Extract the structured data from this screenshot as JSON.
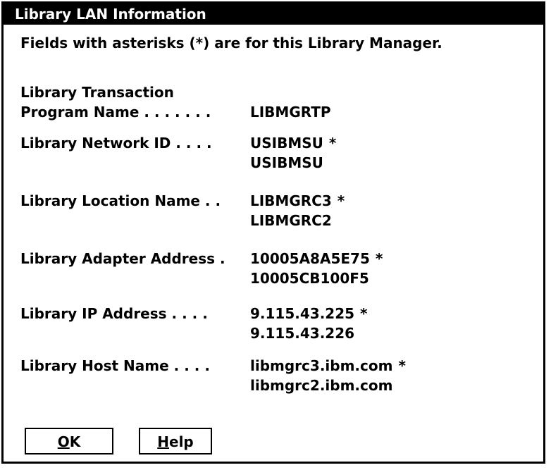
{
  "window": {
    "title": "Library LAN Information",
    "intro": "Fields with asterisks (*) are for this Library Manager."
  },
  "fields": [
    {
      "label_lines": [
        "Library Transaction",
        "Program Name . . . . . . ."
      ],
      "values": [
        {
          "text": "LIBMGRTP",
          "marker": ""
        }
      ]
    },
    {
      "label_lines": [
        "Library Network ID . . . ."
      ],
      "values": [
        {
          "text": "USIBMSU",
          "marker": "*"
        },
        {
          "text": "USIBMSU",
          "marker": ""
        }
      ]
    },
    {
      "label_lines": [
        "Library Location Name . ."
      ],
      "values": [
        {
          "text": "LIBMGRC3",
          "marker": "*"
        },
        {
          "text": "LIBMGRC2",
          "marker": ""
        }
      ]
    },
    {
      "label_lines": [
        "Library Adapter Address ."
      ],
      "values": [
        {
          "text": "10005A8A5E75",
          "marker": "*"
        },
        {
          "text": "10005CB100F5",
          "marker": ""
        }
      ]
    },
    {
      "label_lines": [
        "Library IP Address . . . ."
      ],
      "values": [
        {
          "text": "9.115.43.225",
          "marker": "*"
        },
        {
          "text": "9.115.43.226",
          "marker": ""
        }
      ]
    },
    {
      "label_lines": [
        "Library Host Name . . . ."
      ],
      "values": [
        {
          "text": "libmgrc3.ibm.com",
          "marker": "*"
        },
        {
          "text": "libmgrc2.ibm.com",
          "marker": ""
        }
      ]
    }
  ],
  "buttons": {
    "ok": {
      "mnemonic": "O",
      "rest": "K"
    },
    "help": {
      "mnemonic": "H",
      "rest": "elp"
    }
  }
}
